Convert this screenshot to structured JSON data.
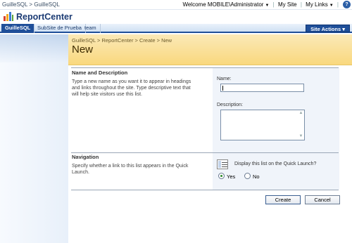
{
  "topbar": {
    "breadcrumb": [
      "GuilleSQL",
      "GuilleSQL"
    ],
    "crumb_sep": ">",
    "welcome": "Welcome MOBILE\\Administrator",
    "my_site": "My Site",
    "my_links": "My Links"
  },
  "site": {
    "title": "ReportCenter"
  },
  "tabs": [
    {
      "label": "GuilleSQL",
      "active": true
    },
    {
      "label": "SubSite de Prueba",
      "active": false
    },
    {
      "label": "team",
      "active": false
    }
  ],
  "site_actions": "Site Actions",
  "page": {
    "breadcrumb": "GuilleSQL > ReportCenter > Create > New",
    "title": "New"
  },
  "sections": {
    "name": {
      "title": "Name and Description",
      "description": "Type a new name as you want it to appear in headings and links throughout the site. Type descriptive text that will help site visitors use this list.",
      "name_label": "Name:",
      "name_value": "",
      "description_label": "Description:",
      "description_value": ""
    },
    "navigation": {
      "title": "Navigation",
      "description": "Specify whether a link to this list appears in the Quick Launch.",
      "question": "Display this list on the Quick Launch?",
      "options": [
        {
          "label": "Yes",
          "checked": true
        },
        {
          "label": "No",
          "checked": false
        }
      ]
    }
  },
  "buttons": {
    "create": "Create",
    "cancel": "Cancel"
  },
  "colors": {
    "accent": "#1f4f99",
    "header_band": "#f9d87e",
    "panel": "#f0f4fa"
  }
}
